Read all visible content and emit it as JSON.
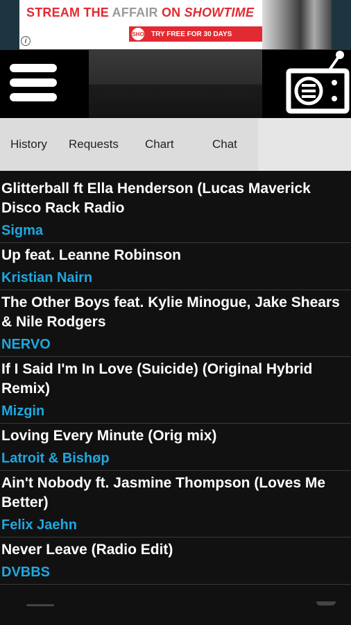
{
  "ad": {
    "headline_part1": "STREAM THE ",
    "headline_part2": "AFFAIR",
    "headline_part3": " ON ",
    "brand": "SHOWTIME",
    "cta": "TRY FREE FOR 30 DAYS",
    "cta_arrow": "▶",
    "badge": "SHO",
    "info": "i"
  },
  "tabs": [
    "History",
    "Requests",
    "Chart",
    "Chat"
  ],
  "history": [
    {
      "title": "Glitterball ft Ella Henderson (Lucas Maverick Disco Rack Radio",
      "artist": "Sigma"
    },
    {
      "title": "Up feat. Leanne Robinson",
      "artist": "Kristian Nairn"
    },
    {
      "title": "The Other Boys feat. Kylie Minogue, Jake Shears & Nile Rodgers",
      "artist": "NERVO"
    },
    {
      "title": "If I Said I'm In Love (Suicide) (Original Hybrid Remix)",
      "artist": "Mizgin"
    },
    {
      "title": "Loving Every Minute (Orig mix)",
      "artist": "Latroit & Bishøp"
    },
    {
      "title": "Ain't Nobody ft. Jasmine Thompson (Loves Me Better)",
      "artist": "Felix Jaehn"
    },
    {
      "title": "Never Leave (Radio Edit)",
      "artist": "DVBBS"
    }
  ],
  "colors": {
    "artist": "#1ea8e0",
    "ad_red": "#e22a33"
  }
}
